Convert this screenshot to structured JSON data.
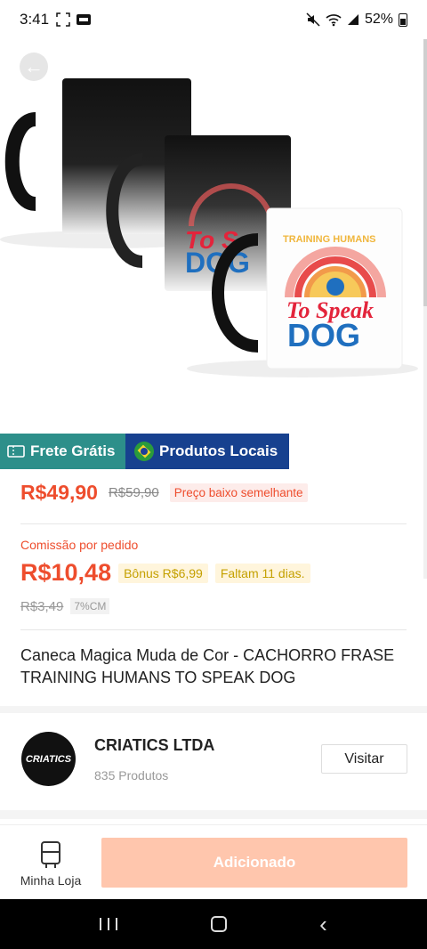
{
  "status_bar": {
    "time": "3:41",
    "battery": "52%"
  },
  "product": {
    "image_alt": "Canecas mágicas - TRAINING HUMANS To Speak DOG",
    "mug_text_1": "To Speak",
    "mug_text_2": "DOG",
    "mug_text_3": "TRAINING HUMANS"
  },
  "badges": {
    "free_shipping": "Frete Grátis",
    "local_products": "Produtos Locais"
  },
  "price": {
    "current": "R$49,90",
    "original": "R$59,90",
    "tag": "Preço baixo semelhante"
  },
  "commission": {
    "label": "Comissão por pedido",
    "value": "R$10,48",
    "bonus": "Bônus R$6,99",
    "deadline": "Faltam 11 dias.",
    "old_value": "R$3,49",
    "rate": "7%CM"
  },
  "title": "Caneca Magica Muda de Cor - CACHORRO FRASE TRAINING HUMANS TO SPEAK DOG",
  "shop": {
    "logo_text": "CRIATICS",
    "name": "CRIATICS LTDA",
    "products": "835 Produtos",
    "visit_label": "Visitar"
  },
  "bottom": {
    "store_label": "Minha Loja",
    "add_label": "Adicionado"
  },
  "colors": {
    "accent": "#ee4d2d",
    "frete": "#2d8f8a",
    "local": "#17418f",
    "add_button": "#ffc6ad"
  },
  "icons": [
    "back-arrow-icon",
    "ticket-icon",
    "brazil-flag-icon",
    "store-icon",
    "recent-apps-icon",
    "home-icon",
    "nav-back-icon"
  ]
}
